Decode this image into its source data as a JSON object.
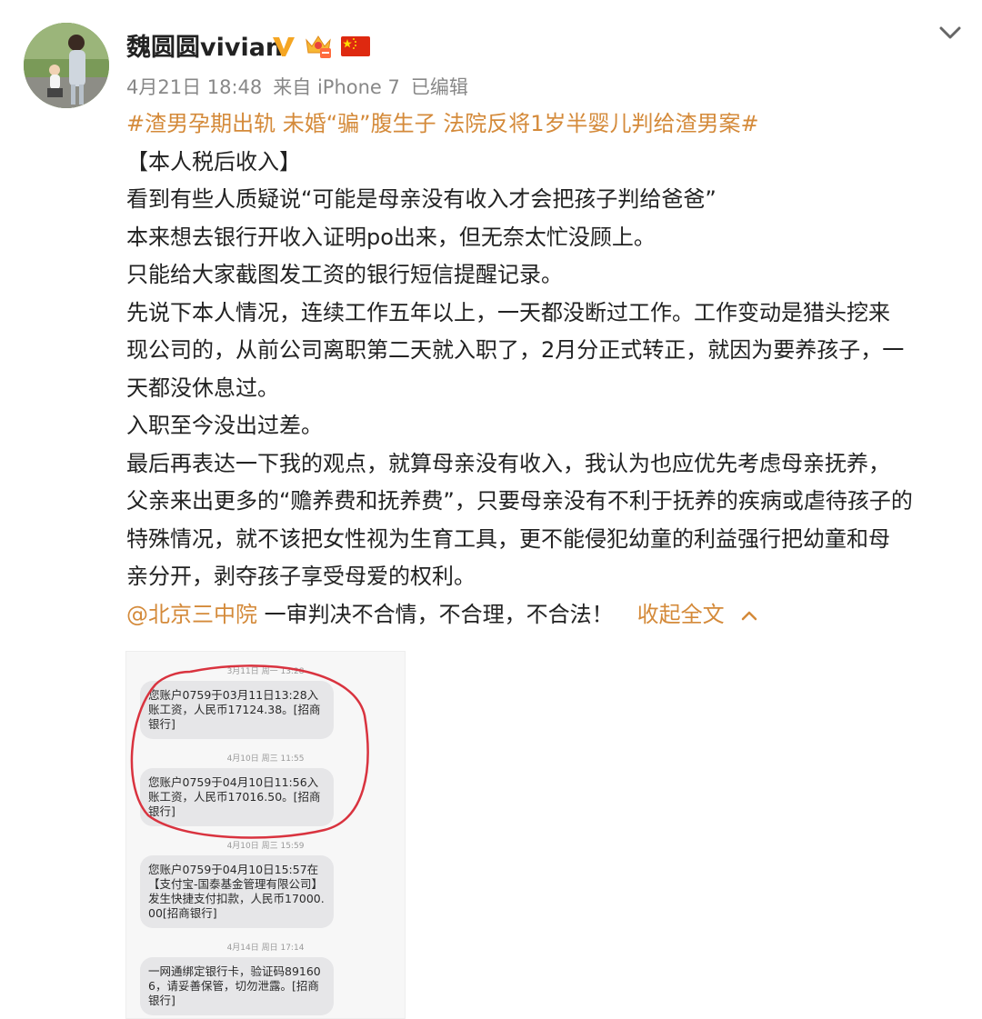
{
  "post": {
    "username": "魏圆圆vivian",
    "date": "4月21日 18:48",
    "source": "来自 iPhone 7",
    "edited": "已编辑",
    "hashtag": "#渣男孕期出轨 未婚“骗”腹生子 法院反将1岁半婴儿判给渣男案#",
    "paragraphs": [
      "【本人税后收入】",
      "看到有些人质疑说“可能是母亲没有收入才会把孩子判给爸爸”",
      "本来想去银行开收入证明po出来，但无奈太忙没顾上。",
      "只能给大家截图发工资的银行短信提醒记录。",
      "先说下本人情况，连续工作五年以上，一天都没断过工作。工作变动是猎头挖来",
      "现公司的，从前公司离职第二天就入职了，2月分正式转正，就因为要养孩子，一",
      "天都没休息过。",
      "入职至今没出过差。",
      "最后再表达一下我的观点，就算母亲没有收入，我认为也应优先考虑母亲抚养，",
      "父亲来出更多的“赡养费和抚养费”，只要母亲没有不利于抚养的疾病或虐待孩子的",
      "特殊情况，就不该把女性视为生育工具，更不能侵犯幼童的利益强行把幼童和母",
      "亲分开，剥夺孩子享受母爱的权利。"
    ],
    "mention": "@北京三中院",
    "closing": " 一审判决不合情，不合理，不合法！",
    "collapse_label": "收起全文"
  },
  "sms": {
    "dates": [
      "3月11日 周一 13:28",
      "4月10日 周三 11:55",
      "4月10日 周三 15:59",
      "4月14日 周日 17:14"
    ],
    "messages": [
      "您账户0759于03月11日13:28入账工资，人民币17124.38。[招商银行]",
      "您账户0759于04月10日11:56入账工资，人民币17016.50。[招商银行]",
      "您账户0759于04月10日15:57在【支付宝-国泰基金管理有限公司】发生快捷支付扣款，人民币17000.00[招商银行]",
      "一网通绑定银行卡，验证码891606，请妥善保管，切勿泄露。[招商银行]"
    ]
  },
  "icons": {
    "verified": "verified-v-icon",
    "crown": "vip-crown-icon",
    "flag": "china-flag-icon",
    "menu": "chevron-down-icon",
    "collapse": "chevron-up-icon"
  },
  "colors": {
    "link": "#d48a3a",
    "verified": "#f5a623",
    "meta": "#888888",
    "annotation": "#d9333f"
  }
}
